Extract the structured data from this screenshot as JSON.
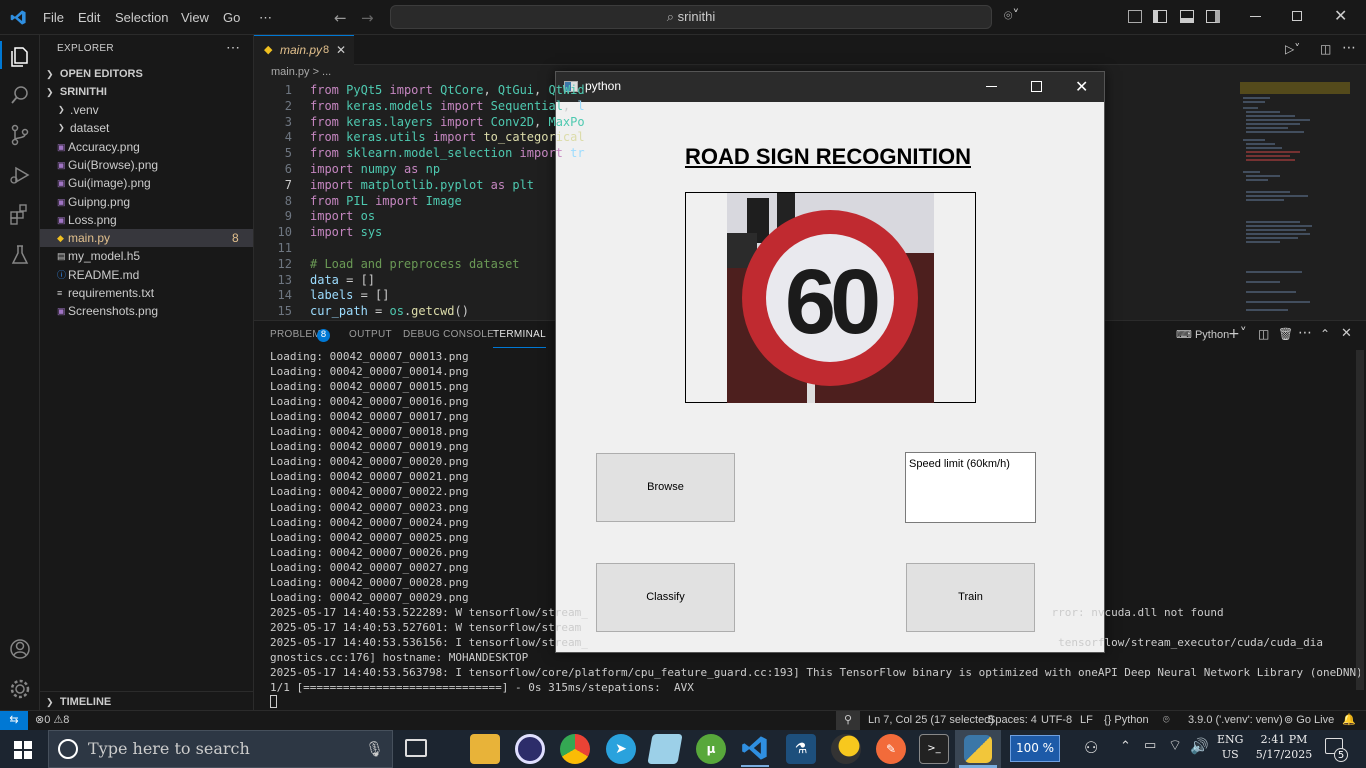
{
  "titlebar": {
    "menus": [
      "File",
      "Edit",
      "Selection",
      "View",
      "Go",
      "⋯"
    ],
    "search": "srinithi"
  },
  "sidebar": {
    "title": "EXPLORER",
    "open_editors": "OPEN EDITORS",
    "root": "SRINITHI",
    "items": [
      {
        "label": ".venv",
        "type": "folder"
      },
      {
        "label": "dataset",
        "type": "folder"
      },
      {
        "label": "Accuracy.png",
        "type": "image"
      },
      {
        "label": "Gui(Browse).png",
        "type": "image"
      },
      {
        "label": "Gui(image).png",
        "type": "image"
      },
      {
        "label": "Guipng.png",
        "type": "image"
      },
      {
        "label": "Loss.png",
        "type": "image"
      },
      {
        "label": "main.py",
        "type": "python",
        "badge": "8"
      },
      {
        "label": "my_model.h5",
        "type": "file"
      },
      {
        "label": "README.md",
        "type": "info"
      },
      {
        "label": "requirements.txt",
        "type": "text"
      },
      {
        "label": "Screenshots.png",
        "type": "image"
      }
    ],
    "timeline": "TIMELINE"
  },
  "editor": {
    "tab_label": "main.py",
    "tab_badge": "8",
    "breadcrumb": "main.py > ...",
    "code": [
      {
        "n": "1",
        "t": "from PyQt5 import QtCore, QtGui, QtWid"
      },
      {
        "n": "2",
        "t": "from keras.models import Sequential, l"
      },
      {
        "n": "3",
        "t": "from keras.layers import Conv2D, MaxPo"
      },
      {
        "n": "4",
        "t": "from keras.utils import to_categorical"
      },
      {
        "n": "5",
        "t": "from sklearn.model_selection import tr"
      },
      {
        "n": "6",
        "t": "import numpy as np"
      },
      {
        "n": "7",
        "t": "import matplotlib.pyplot as plt"
      },
      {
        "n": "8",
        "t": "from PIL import Image"
      },
      {
        "n": "9",
        "t": "import os"
      },
      {
        "n": "10",
        "t": "import sys"
      },
      {
        "n": "11",
        "t": ""
      },
      {
        "n": "12",
        "t": "# Load and preprocess dataset"
      },
      {
        "n": "13",
        "t": "data = []"
      },
      {
        "n": "14",
        "t": "labels = []"
      },
      {
        "n": "15",
        "t": "cur_path = os.getcwd()"
      }
    ]
  },
  "panel": {
    "tabs": [
      "PROBLEMS",
      "OUTPUT",
      "DEBUG CONSOLE",
      "TERMINAL"
    ],
    "problems_badge": "8",
    "shell": "Python",
    "terminal_lines": [
      "Loading: 00042_00007_00013.png",
      "Loading: 00042_00007_00014.png",
      "Loading: 00042_00007_00015.png",
      "Loading: 00042_00007_00016.png",
      "Loading: 00042_00007_00017.png",
      "Loading: 00042_00007_00018.png",
      "Loading: 00042_00007_00019.png",
      "Loading: 00042_00007_00020.png",
      "Loading: 00042_00007_00021.png",
      "Loading: 00042_00007_00022.png",
      "Loading: 00042_00007_00023.png",
      "Loading: 00042_00007_00024.png",
      "Loading: 00042_00007_00025.png",
      "Loading: 00042_00007_00026.png",
      "Loading: 00042_00007_00027.png",
      "Loading: 00042_00007_00028.png",
      "Loading: 00042_00007_00029.png",
      "2025-05-17 14:40:53.522289: W tensorflow/stream_                                                                      rror: nvcuda.dll not found",
      "2025-05-17 14:40:53.527601: W tensorflow/stream",
      "2025-05-17 14:40:53.536156: I tensorflow/stream_                                                                       tensorflow/stream_executor/cuda/cuda_dia",
      "gnostics.cc:176] hostname: MOHANDESKTOP",
      "2025-05-17 14:40:53.563798: I tensorflow/core/platform/cpu_feature_guard.cc:193] This TensorFlow binary is optimized with oneAPI Deep Neural Network Library (oneDNN) to use the fol",
      "1/1 [==============================] - 0s 315ms/stepations:  AVX"
    ]
  },
  "statusbar": {
    "errors": "0",
    "warnings": "8",
    "position": "Ln 7, Col 25 (17 selected)",
    "spaces": "Spaces: 4",
    "encoding": "UTF-8",
    "eol": "LF",
    "language": "Python",
    "interpreter": "3.9.0 ('.venv': venv)",
    "golive": "Go Live"
  },
  "pywindow": {
    "title": "python",
    "heading": "ROAD SIGN RECOGNITION",
    "sign_text": "60",
    "browse": "Browse",
    "result": "Speed limit (60km/h)",
    "classify": "Classify",
    "train": "Train"
  },
  "taskbar": {
    "search_placeholder": "Type here to search",
    "battery": "100 %",
    "lang": "ENG",
    "region": "US",
    "time": "2:41 PM",
    "date": "5/17/2025",
    "notif_count": "5"
  },
  "colors": {
    "accent": "#0078d4",
    "warning": "#cca700"
  }
}
